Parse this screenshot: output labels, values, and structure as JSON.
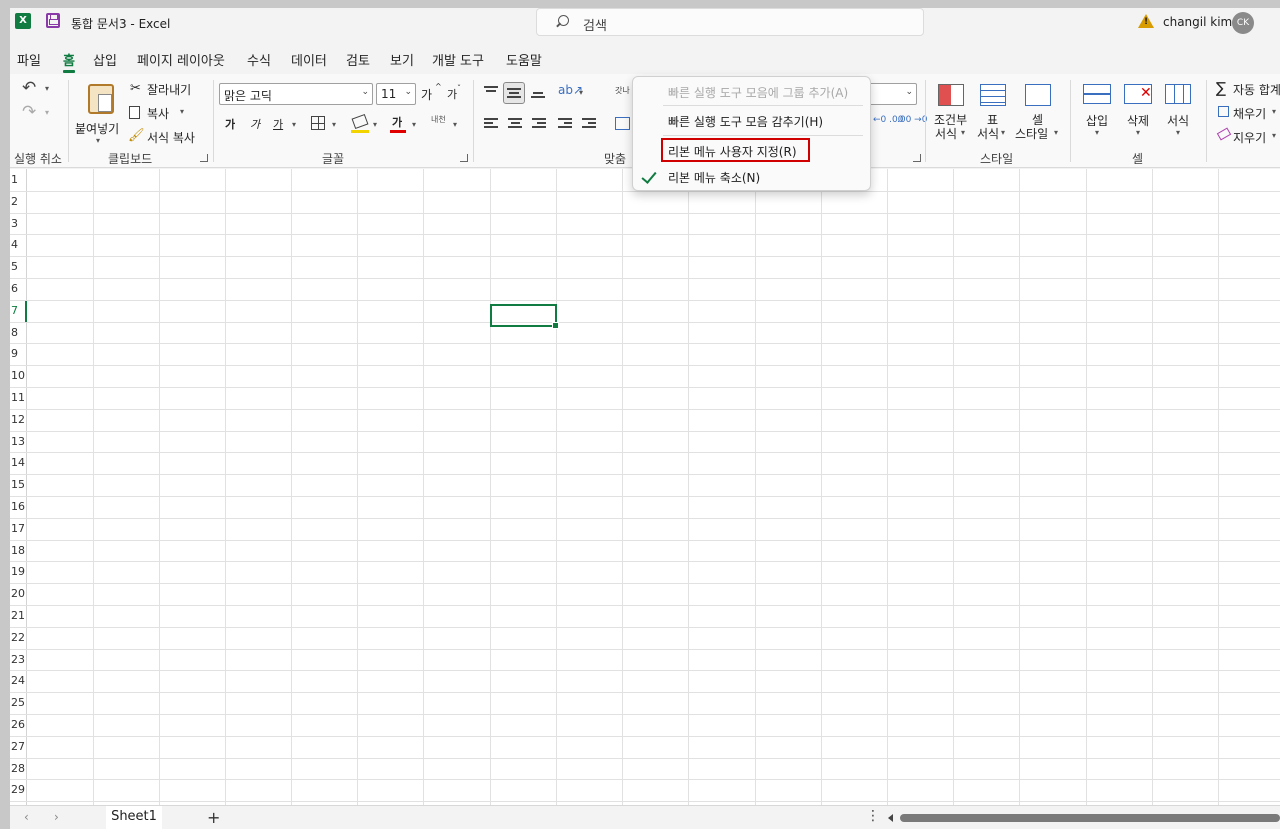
{
  "titlebar": {
    "app_icon_letter": "X",
    "doc_title": "통합 문서3  -  Excel",
    "search_placeholder": "검색",
    "user_name": "changil kim",
    "avatar_initials": "CK",
    "warn_glyph": "!"
  },
  "tabs": [
    "파일",
    "홈",
    "삽입",
    "페이지 레이아웃",
    "수식",
    "데이터",
    "검토",
    "보기",
    "개발 도구",
    "도움말"
  ],
  "active_tab": "홈",
  "ribbon": {
    "undo_group": "실행 취소",
    "clipboard": {
      "paste": "붙여넣기",
      "cut": "잘라내기",
      "copy": "복사",
      "format_painter": "서식 복사",
      "group": "클립보드"
    },
    "font": {
      "font_name": "맑은 고딕",
      "font_size": "11",
      "grow": "가",
      "shrink": "가",
      "bold": "가",
      "italic": "가",
      "underline": "가",
      "font_color": "가",
      "phonetic": "내천",
      "group": "글꼴"
    },
    "alignment": {
      "wrap": "갓나",
      "group": "맞춤"
    },
    "number": {
      "increase_decimal": "←0 .00",
      "decrease_decimal": ".00 →0"
    },
    "styles": {
      "conditional": [
        "조건부",
        "서식"
      ],
      "table": [
        "표",
        "서식"
      ],
      "cell_styles": [
        "셀",
        "스타일"
      ],
      "group": "스타일"
    },
    "cells": {
      "insert": "삽입",
      "delete": "삭제",
      "format": "서식",
      "group": "셀"
    },
    "editing": {
      "autosum": "자동 합계",
      "fill": "채우기",
      "clear": "지우기"
    },
    "accent": "#107c41"
  },
  "context_menu": {
    "items": [
      {
        "label": "빠른 실행 도구 모음에 그룹 추가(A)",
        "enabled": false
      },
      {
        "label": "빠른 실행 도구 모음 감추기(H)",
        "enabled": true
      },
      {
        "label": "리본 메뉴 사용자 지정(R)",
        "enabled": true,
        "highlighted": true
      },
      {
        "label": "리본 메뉴 축소(N)",
        "enabled": true,
        "checked": true
      }
    ],
    "highlight_color": "#d10000"
  },
  "grid": {
    "rows": [
      "1",
      "2",
      "3",
      "4",
      "5",
      "6",
      "7",
      "8",
      "9",
      "10",
      "11",
      "12",
      "13",
      "14",
      "15",
      "16",
      "17",
      "18",
      "19",
      "20",
      "21",
      "22",
      "23",
      "24",
      "25",
      "26",
      "27",
      "28",
      "29"
    ],
    "active_row": "7"
  },
  "sheets": {
    "tabs": [
      "Sheet1"
    ],
    "add": "+",
    "more": "⋮"
  }
}
